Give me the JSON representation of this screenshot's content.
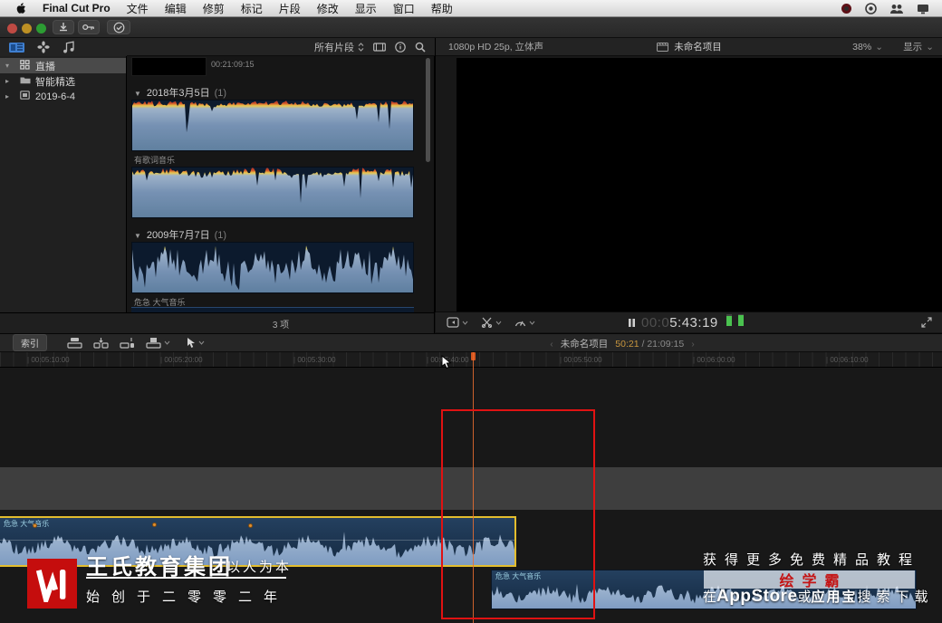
{
  "menu_bar": {
    "app_name": "Final Cut Pro",
    "menus": [
      "文件",
      "编辑",
      "修剪",
      "标记",
      "片段",
      "修改",
      "显示",
      "窗口",
      "帮助"
    ]
  },
  "sidebar": {
    "items": [
      {
        "label": "直播"
      },
      {
        "label": "智能精选"
      },
      {
        "label": "2019-6-4"
      }
    ]
  },
  "browser": {
    "filter": "所有片段",
    "strip_timecode": "00:21:09:15",
    "group1_title": "2018年3月5日",
    "group1_count": "(1)",
    "clip1_label": "有歌词音乐",
    "group2_title": "2009年7月7日",
    "group2_count": "(1)",
    "clip2_label": "危急 大气音乐",
    "status": "3 项"
  },
  "viewer": {
    "format": "1080p HD 25p, 立体声",
    "title": "未命名项目",
    "zoom": "38%",
    "zoom_caret": "⌄",
    "view": "显示",
    "view_caret": "⌄",
    "tc_dim": "00:0",
    "tc": "5:43:19"
  },
  "timeline": {
    "index": "索引",
    "title": "未命名项目",
    "tc_current": "50:21",
    "tc_total": "/ 21:09:15",
    "chev_left": "‹",
    "chev_right": "›",
    "ruler": [
      "00:05:10:00",
      "00:05:20:00",
      "00:05:30:00",
      "00:05:40:00",
      "00:05:50:00",
      "00:06:00:00",
      "00:06:10:00"
    ],
    "clip1_label": "危急 大气音乐",
    "clip2_label": "危急 大气音乐"
  },
  "watermark": {
    "brand": "王氏教育集团",
    "slogan": "以人为本",
    "line2": "始创于二零零二年"
  },
  "promo": {
    "line1": "获得更多免费精品教程",
    "brand": "绘学霸",
    "l2a": "在",
    "l2b": "AppStore",
    "l2c": "或",
    "l2d": "应用宝",
    "l2e": "搜索下载"
  },
  "colors": {
    "accent_orange": "#c8963e",
    "selection_yellow": "#e3bd2e",
    "annotation_red": "#e01212",
    "meter_green": "#4ac24f",
    "waveform_blue": "#7f9cc2"
  }
}
